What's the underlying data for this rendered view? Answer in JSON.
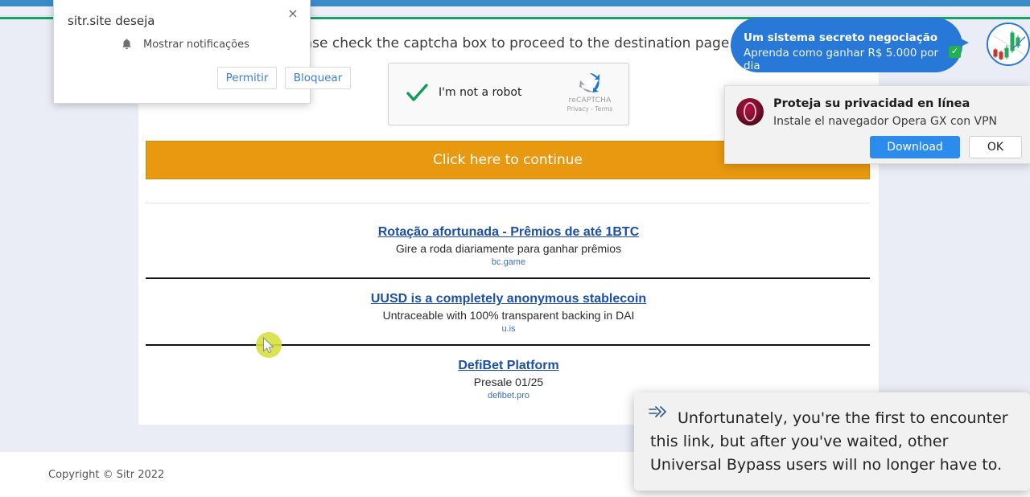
{
  "browser": {
    "chrome_bar_color": "#3a8cc6",
    "url_strip_color": "#eceff7"
  },
  "page": {
    "accent_green": "#18a06a",
    "background": "#eaedf6",
    "intro_text": "Please check the captcha box to proceed to the destination page.",
    "cta_label": "Click here to continue",
    "cta_color": "#e8990f",
    "footer_text": "Copyright © Sitr 2022"
  },
  "recaptcha": {
    "label": "I'm not a robot",
    "checked": true,
    "brand": "reCAPTCHA",
    "legal": "Privacy - Terms",
    "check_color": "#0f9d58"
  },
  "ads": [
    {
      "title": "Rotação afortunada - Prêmios de até 1BTC",
      "description": "Gire a roda diariamente para ganhar prêmios",
      "domain": "bc.game"
    },
    {
      "title": "UUSD is a completely anonymous stablecoin",
      "description": "Untraceable with 100% transparent backing in DAI",
      "domain": "u.is"
    },
    {
      "title": "DefiBet Platform",
      "description": "Presale 01/25",
      "domain": "defibet.pro"
    }
  ],
  "permission_dialog": {
    "title": "sitr.site deseja",
    "row_label": "Mostrar notificações",
    "allow_label": "Permitir",
    "block_label": "Bloquear",
    "close_label": "×",
    "link_color": "#3b7ddd"
  },
  "trading_ad": {
    "headline": "Um sistema secreto negociação",
    "subline": "Aprenda como ganhar R$ 5.000 por dia",
    "check_mark": "✓",
    "bubble_color": "#2878d8",
    "badge_color": "#21b24b"
  },
  "opera_toast": {
    "title": "Proteja su privacidad en línea",
    "subtitle": "Instale el navegador Opera GX con VPN",
    "download_label": "Download",
    "ok_label": "OK",
    "download_color": "#2b8ced"
  },
  "bypass_tooltip": {
    "text": "Unfortunately, you're the first to encounter this link, but after you've waited, other Universal Bypass users will no longer have to."
  },
  "cursor": {
    "halo_color": "#d7e03f"
  }
}
